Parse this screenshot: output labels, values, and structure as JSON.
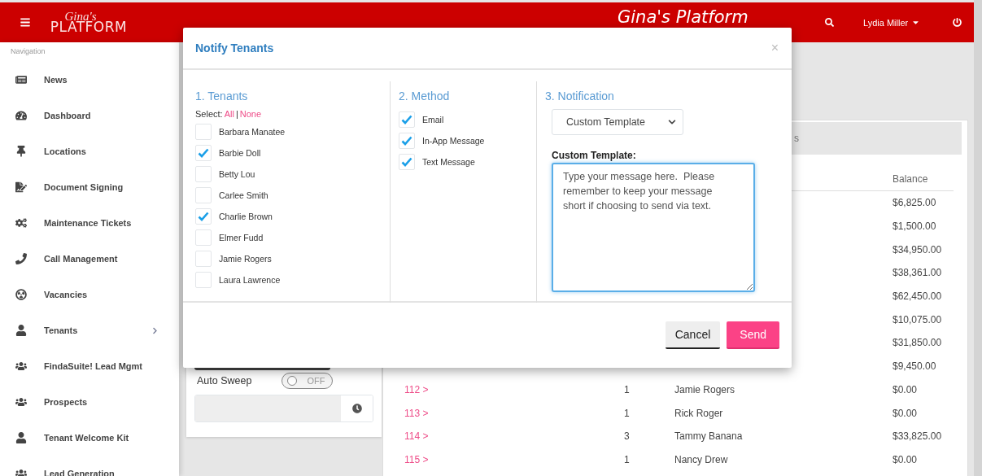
{
  "header": {
    "logo_script": "Gina's",
    "logo_word": "PLATFORM",
    "title": "Gina's Platform",
    "user": "Lydia Miller"
  },
  "sidebar": {
    "heading": "Navigation",
    "items": [
      {
        "label": "News",
        "has_submenu": false
      },
      {
        "label": "Dashboard",
        "has_submenu": false
      },
      {
        "label": "Locations",
        "has_submenu": false
      },
      {
        "label": "Document Signing",
        "has_submenu": false
      },
      {
        "label": "Maintenance Tickets",
        "has_submenu": false
      },
      {
        "label": "Call Management",
        "has_submenu": false
      },
      {
        "label": "Vacancies",
        "has_submenu": false
      },
      {
        "label": "Tenants",
        "has_submenu": true
      },
      {
        "label": "FindaSuite! Lead Mgmt",
        "has_submenu": false
      },
      {
        "label": "Prospects",
        "has_submenu": false
      },
      {
        "label": "Tenant Welcome Kit",
        "has_submenu": false
      },
      {
        "label": "Lead Generation",
        "has_submenu": false
      }
    ]
  },
  "settings_card": {
    "auto_sweep": {
      "label": "Auto Sweep",
      "on": false,
      "state_text": "OFF"
    }
  },
  "units_card": {
    "header_text": "s",
    "columns": [
      {
        "label": "Balance"
      }
    ],
    "rows": [
      {
        "balance": "$6,825.00"
      },
      {
        "balance": "$1,500.00"
      },
      {
        "balance": "$34,950.00"
      },
      {
        "balance": "$38,361.00"
      },
      {
        "balance": "$62,450.00"
      },
      {
        "balance": "$10,075.00"
      },
      {
        "balance": "$31,850.00"
      },
      {
        "balance": "$9,450.00"
      },
      {
        "unit": "112 >",
        "count": "1",
        "name": "Jamie Rogers",
        "balance": "$0.00"
      },
      {
        "unit": "113 >",
        "count": "1",
        "name": "Rick Roger",
        "balance": "$0.00"
      },
      {
        "unit": "114 >",
        "count": "3",
        "name": "Tammy Banana",
        "balance": "$33,825.00"
      },
      {
        "unit": "115 >",
        "count": "1",
        "name": "Nancy Drew",
        "balance": "$0.00"
      }
    ]
  },
  "modal": {
    "title": "Notify Tenants",
    "close": "×",
    "tenants": {
      "title": "1. Tenants",
      "select_label": "Select:",
      "select_all": "All",
      "separator": "|",
      "select_none": "None",
      "items": [
        {
          "name": "Barbara Manatee",
          "checked": false
        },
        {
          "name": "Barbie Doll",
          "checked": true
        },
        {
          "name": "Betty Lou",
          "checked": false
        },
        {
          "name": "Carlee Smith",
          "checked": false
        },
        {
          "name": "Charlie Brown",
          "checked": true
        },
        {
          "name": "Elmer Fudd",
          "checked": false
        },
        {
          "name": "Jamie Rogers",
          "checked": false
        },
        {
          "name": "Laura Lawrence",
          "checked": false
        }
      ]
    },
    "method": {
      "title": "2. Method",
      "items": [
        {
          "name": "Email",
          "checked": true
        },
        {
          "name": "In-App Message",
          "checked": true
        },
        {
          "name": "Text Message",
          "checked": true
        }
      ]
    },
    "notification": {
      "title": "3. Notification",
      "template_select": "Custom Template",
      "template_label": "Custom Template:",
      "placeholder": "Type your message here.  Please remember to keep your message short if choosing to send via text."
    },
    "buttons": [
      {
        "label": "Cancel",
        "kind": "default"
      },
      {
        "label": "Send",
        "kind": "primary"
      }
    ]
  }
}
